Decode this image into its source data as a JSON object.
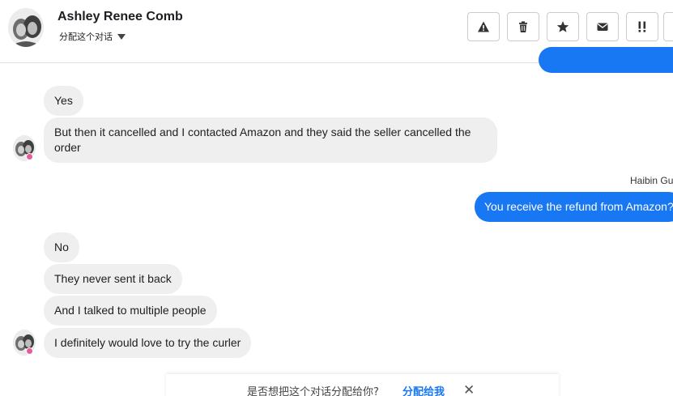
{
  "header": {
    "contact_name": "Ashley Renee Comb",
    "assign_label": "分配这个对话",
    "tools": [
      {
        "icon": "warning-icon"
      },
      {
        "icon": "trash-icon"
      },
      {
        "icon": "star-icon"
      },
      {
        "icon": "envelope-icon"
      },
      {
        "icon": "spam-icon",
        "text": "!!"
      }
    ]
  },
  "messages": {
    "m1": "Yes",
    "m2": "But then it cancelled and I contacted Amazon and they said the seller cancelled the order",
    "sender_name": "Haibin Gu",
    "m3": "You receive the refund from Amazon?",
    "m4": "No",
    "m5": "They never sent it back",
    "m6": "And I talked to multiple people",
    "m7": "I definitely would love to try the curler"
  },
  "assign_bar": {
    "question": "是否想把这个对话分配给你?",
    "link": "分配给我",
    "close": "✕"
  },
  "colors": {
    "outgoing": "#1877f2",
    "incoming": "#efefef",
    "border": "#dddfe2"
  }
}
